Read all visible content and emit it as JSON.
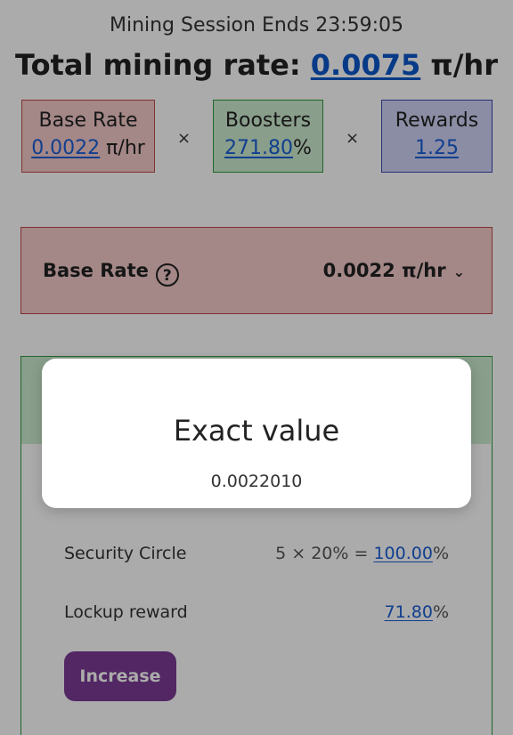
{
  "header": {
    "session_text": "Mining Session Ends 23:59:05",
    "total_label": "Total mining rate: ",
    "total_value": "0.0075",
    "total_unit": " π/hr"
  },
  "factors": {
    "base": {
      "label": "Base Rate",
      "value": "0.0022",
      "unit": " π/hr"
    },
    "times1": "×",
    "boosters": {
      "label": "Boosters",
      "value": "271.80",
      "unit": "%"
    },
    "times2": "×",
    "rewards": {
      "label": "Rewards",
      "value": "1.25"
    }
  },
  "base_panel": {
    "label": "Base Rate",
    "help": "?",
    "value": "0.0022 π/hr",
    "chevron": "⌄"
  },
  "booster_rows": [
    {
      "label": "Security Circle",
      "formula": "5 × 20% = ",
      "value": "100.00",
      "unit": "%"
    },
    {
      "label": "Lockup reward",
      "formula": "",
      "value": "71.80",
      "unit": "%"
    }
  ],
  "increase_label": "Increase",
  "modal": {
    "title": "Exact value",
    "value": "0.0022010"
  },
  "colors": {
    "base_bg": "#f5c9c9",
    "boost_bg": "#cdeccf",
    "reward_bg": "#cfd3f5",
    "link": "#1a5fd6",
    "button": "#7b3b94"
  }
}
